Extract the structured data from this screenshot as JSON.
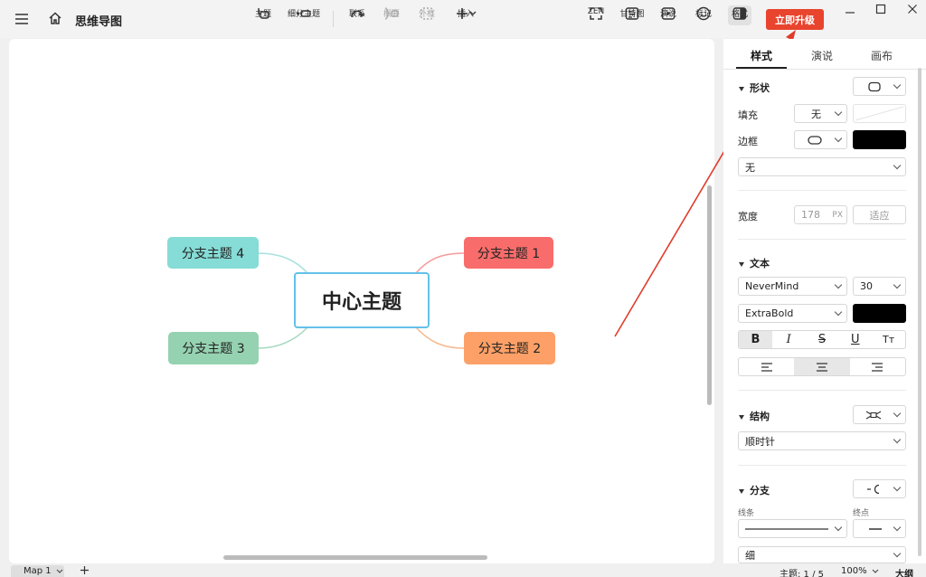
{
  "app": {
    "title": "思维导图"
  },
  "toolbar": {
    "topic": "主题",
    "subtopic": "细分主题",
    "relationship": "联系",
    "summary": "概要",
    "boundary": "外框",
    "insert": "插入",
    "zen": "ZEN",
    "gantt": "甘特图",
    "pitch": "演说",
    "sticker": "标记",
    "format": "格式",
    "upgrade": "立即升级"
  },
  "map": {
    "central": "中心主题",
    "branches": [
      "分支主题 1",
      "分支主题 2",
      "分支主题 3",
      "分支主题 4"
    ]
  },
  "sidebar": {
    "tabs": [
      "样式",
      "演说",
      "画布"
    ],
    "shape": {
      "title": "形状",
      "fill_label": "填充",
      "fill_value": "无",
      "border_label": "边框",
      "border_style": "无"
    },
    "width": {
      "label": "宽度",
      "value": "178",
      "unit": "PX",
      "fit": "适应"
    },
    "text": {
      "title": "文本",
      "font": "NeverMind",
      "size": "30",
      "weight": "ExtraBold",
      "bold": "B",
      "italic": "I",
      "strike": "S",
      "underline": "U",
      "case": "Tт"
    },
    "structure": {
      "title": "结构",
      "value": "顺时针"
    },
    "branch": {
      "title": "分支",
      "line_label": "线条",
      "end_label": "终点",
      "thickness": "细"
    }
  },
  "statusbar": {
    "sheet": "Map 1",
    "topic_count": "主题: 1 / 5",
    "zoom": "100%",
    "outline": "大纲"
  },
  "colors": {
    "branch1": "#f86c6b",
    "branch2": "#fda067",
    "branch3": "#95d2b1",
    "branch4": "#86dcd6",
    "upgrade": "#e8442e",
    "accent_border": "#63c1ea",
    "arrow": "#e03b2a"
  }
}
